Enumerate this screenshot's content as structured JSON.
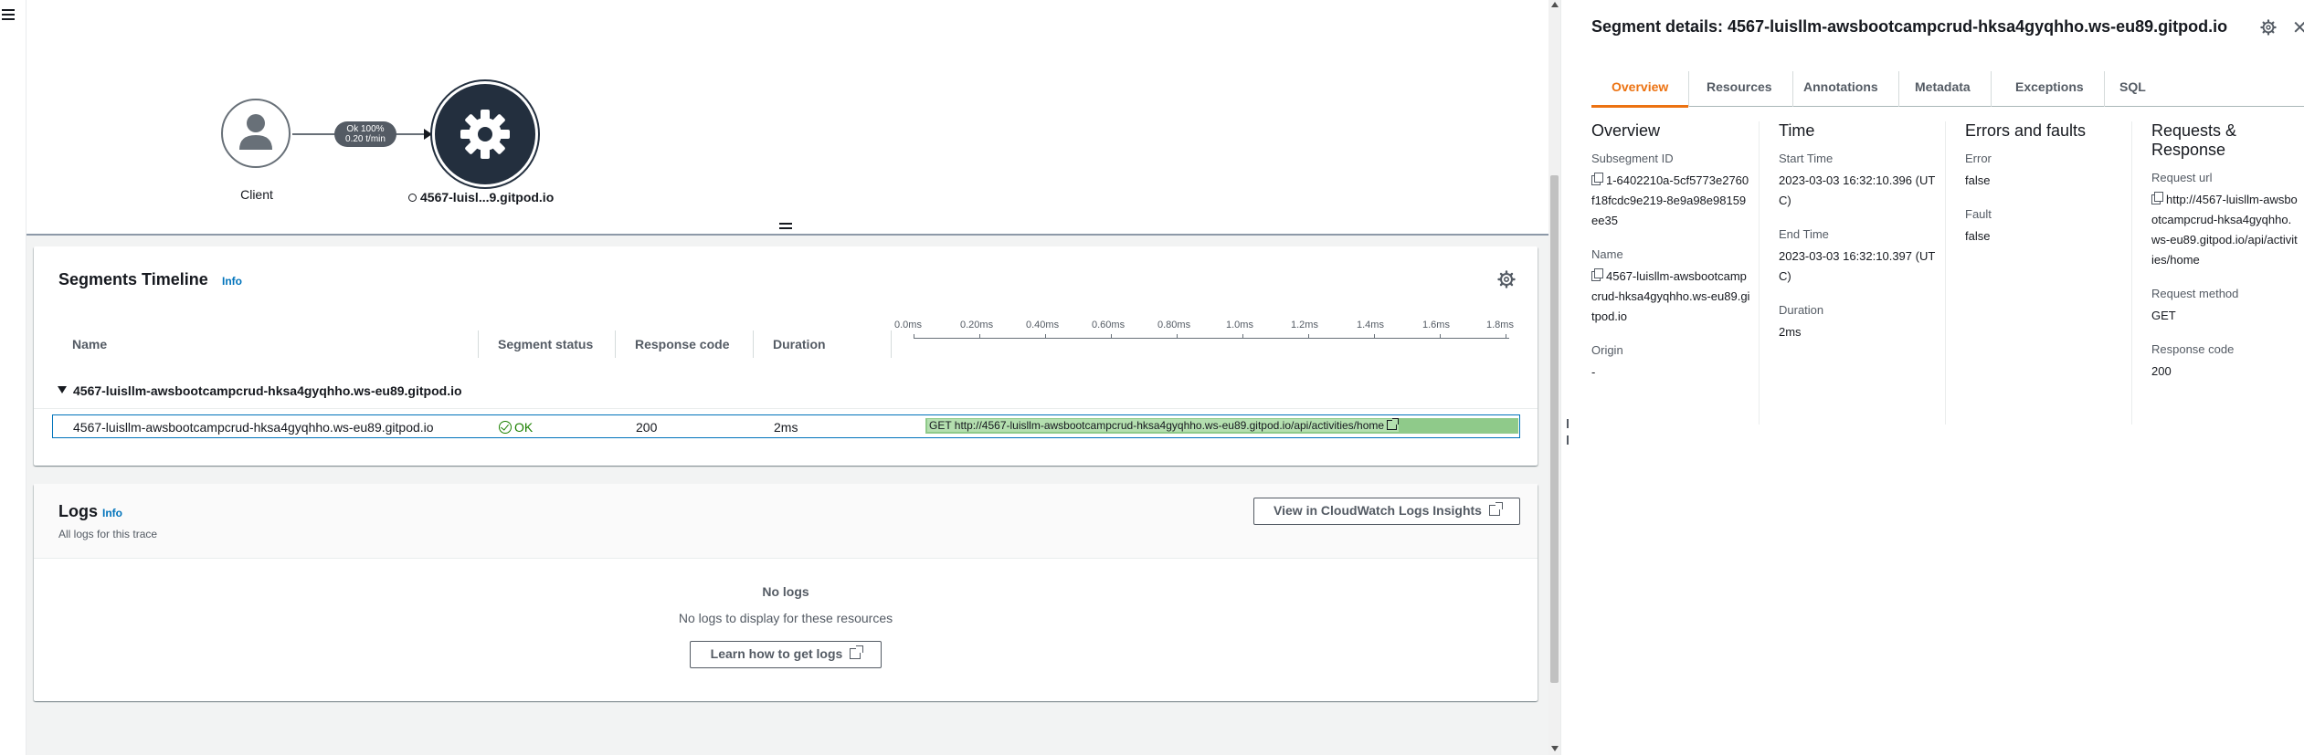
{
  "map": {
    "client_label": "Client",
    "edge_line1": "Ok 100%",
    "edge_line2": "0.20 t/min",
    "service_label": "4567-luisl...9.gitpod.io"
  },
  "timeline": {
    "title": "Segments Timeline",
    "info": "Info",
    "columns": {
      "name": "Name",
      "status": "Segment status",
      "code": "Response code",
      "duration": "Duration"
    },
    "axis_ticks": [
      "0.0ms",
      "0.20ms",
      "0.40ms",
      "0.60ms",
      "0.80ms",
      "1.0ms",
      "1.2ms",
      "1.4ms",
      "1.6ms",
      "1.8ms"
    ],
    "group_name": "4567-luisllm-awsbootcampcrud-hksa4gyqhho.ws-eu89.gitpod.io",
    "segment": {
      "name": "4567-luisllm-awsbootcampcrud-hksa4gyqhho.ws-eu89.gitpod.io",
      "status": "OK",
      "code": "200",
      "duration": "2ms",
      "bar_label": "GET http://4567-luisllm-awsbootcampcrud-hksa4gyqhho.ws-eu89.gitpod.io/api/activities/home"
    }
  },
  "logs": {
    "title": "Logs",
    "info": "Info",
    "subtitle": "All logs for this trace",
    "cloudwatch_button": "View in CloudWatch Logs Insights",
    "empty_title": "No logs",
    "empty_desc": "No logs to display for these resources",
    "learn_button": "Learn how to get logs"
  },
  "details": {
    "title": "Segment details: 4567-luisllm-awsbootcampcrud-hksa4gyqhho.ws-eu89.gitpod.io",
    "tabs": [
      "Overview",
      "Resources",
      "Annotations",
      "Metadata",
      "Exceptions",
      "SQL"
    ],
    "active_tab": "Overview",
    "overview": {
      "heading": "Overview",
      "subsegment_label": "Subsegment ID",
      "subsegment_value": "1-6402210a-5cf5773e2760f18fcdc9e219-8e9a98e98159ee35",
      "name_label": "Name",
      "name_value": "4567-luisllm-awsbootcampcrud-hksa4gyqhho.ws-eu89.gitpod.io",
      "origin_label": "Origin",
      "origin_value": "-"
    },
    "time": {
      "heading": "Time",
      "start_label": "Start Time",
      "start_value": "2023-03-03 16:32:10.396 (UTC)",
      "end_label": "End Time",
      "end_value": "2023-03-03 16:32:10.397 (UTC)",
      "duration_label": "Duration",
      "duration_value": "2ms"
    },
    "errors": {
      "heading": "Errors and faults",
      "error_label": "Error",
      "error_value": "false",
      "fault_label": "Fault",
      "fault_value": "false"
    },
    "request": {
      "heading": "Requests & Response",
      "url_label": "Request url",
      "url_value": "http://4567-luisllm-awsbootcampcrud-hksa4gyqhho.ws-eu89.gitpod.io/api/activities/home",
      "method_label": "Request method",
      "method_value": "GET",
      "code_label": "Response code",
      "code_value": "200"
    }
  },
  "colors": {
    "accent": "#ec7211",
    "link": "#0073bb",
    "ok": "#1d8102",
    "bar": "#8fca8a",
    "node": "#232f3e"
  }
}
